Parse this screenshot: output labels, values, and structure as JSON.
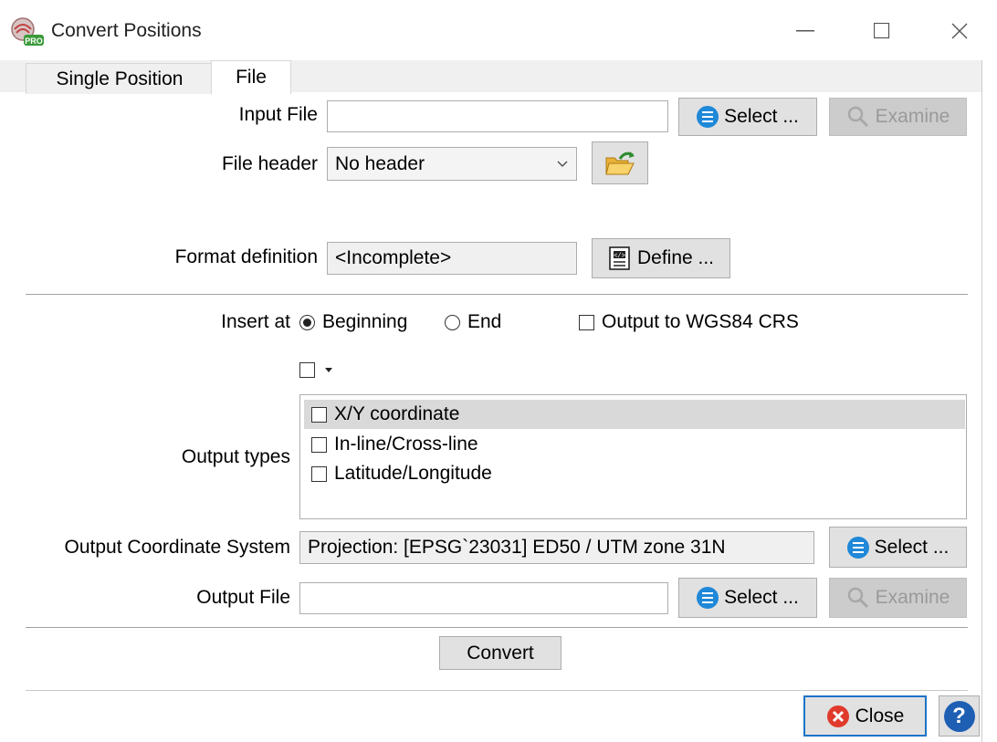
{
  "window": {
    "title": "Convert Positions",
    "minimize": "—",
    "maximize": "☐",
    "close": "✕"
  },
  "tabs": [
    {
      "label": "Single Position",
      "active": false
    },
    {
      "label": "File",
      "active": true
    }
  ],
  "input_file": {
    "label": "Input File",
    "value": "",
    "select_label": "Select ...",
    "examine_label": "Examine"
  },
  "file_header": {
    "label": "File header",
    "value": "No header"
  },
  "format_definition": {
    "label": "Format definition",
    "value": "<Incomplete>",
    "define_label": "Define ..."
  },
  "insert_at": {
    "label": "Insert at",
    "options": [
      {
        "label": "Beginning",
        "checked": true
      },
      {
        "label": "End",
        "checked": false
      }
    ],
    "wgs84_label": "Output to WGS84 CRS",
    "wgs84_checked": false
  },
  "output_types": {
    "label": "Output types",
    "items": [
      {
        "label": "X/Y coordinate",
        "checked": false,
        "selected": true
      },
      {
        "label": "In-line/Cross-line",
        "checked": false,
        "selected": false
      },
      {
        "label": "Latitude/Longitude",
        "checked": false,
        "selected": false
      }
    ]
  },
  "output_crs": {
    "label": "Output Coordinate System",
    "value": "Projection: [EPSG`23031] ED50 / UTM zone 31N",
    "select_label": "Select ..."
  },
  "output_file": {
    "label": "Output File",
    "value": "",
    "select_label": "Select ...",
    "examine_label": "Examine"
  },
  "convert_label": "Convert",
  "close_label": "Close",
  "help_label": "?"
}
